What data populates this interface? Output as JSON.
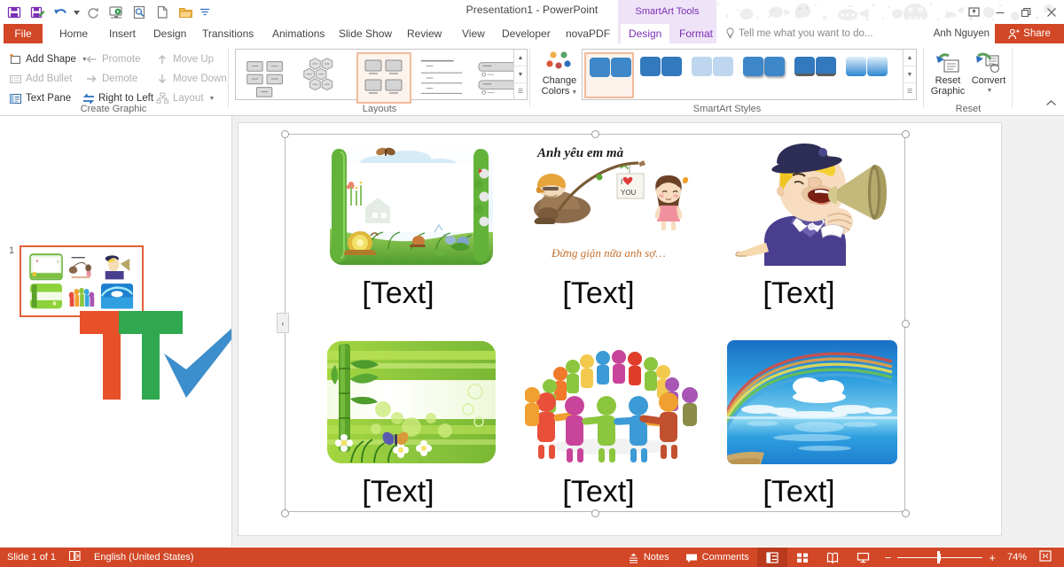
{
  "window": {
    "title": "Presentation1 - PowerPoint",
    "context_tools_label": "SmartArt Tools",
    "buttons": {
      "ribbon_display": "ribbon-display-options-icon",
      "minimize": "–",
      "restore": "❐",
      "close": "✕"
    }
  },
  "quick_access": [
    {
      "name": "save-icon",
      "label": "Save"
    },
    {
      "name": "save-as-icon",
      "label": "Save As"
    },
    {
      "name": "undo-icon",
      "label": "Undo"
    },
    {
      "name": "redo-icon",
      "label": "Redo"
    },
    {
      "name": "start-from-beginning-icon",
      "label": "Start From Beginning"
    },
    {
      "name": "print-preview-icon",
      "label": "Print Preview and Print"
    },
    {
      "name": "new-icon",
      "label": "New"
    },
    {
      "name": "open-icon",
      "label": "Open"
    },
    {
      "name": "customize-qat-icon",
      "label": "Customize Quick Access Toolbar"
    }
  ],
  "tabs": {
    "file": "File",
    "items": [
      "Home",
      "Insert",
      "Design",
      "Transitions",
      "Animations",
      "Slide Show",
      "Review",
      "View",
      "Developer",
      "novaPDF"
    ],
    "contextual": [
      "Design",
      "Format"
    ],
    "active_contextual": "Design"
  },
  "tellme": {
    "placeholder": "Tell me what you want to do...",
    "icon": "lightbulb-icon"
  },
  "account": {
    "user": "Anh Nguyen",
    "share_label": "Share",
    "share_icon": "person-share-icon"
  },
  "ribbon": {
    "collapse_icon": "chevron-up-icon",
    "groups": [
      {
        "name": "create-graphic",
        "label": "Create Graphic",
        "commands": [
          {
            "label": "Add Shape",
            "icon": "add-shape-icon",
            "enabled": true,
            "dropdown": true
          },
          {
            "label": "Add Bullet",
            "icon": "add-bullet-icon",
            "enabled": false,
            "dropdown": false
          },
          {
            "label": "Text Pane",
            "icon": "text-pane-icon",
            "enabled": true,
            "dropdown": false
          },
          {
            "label": "Promote",
            "icon": "promote-arrow-icon",
            "enabled": false,
            "dropdown": false
          },
          {
            "label": "Demote",
            "icon": "demote-arrow-icon",
            "enabled": false,
            "dropdown": false
          },
          {
            "label": "Right to Left",
            "icon": "right-to-left-icon",
            "enabled": true,
            "dropdown": false
          },
          {
            "label": "Move Up",
            "icon": "move-up-arrow-icon",
            "enabled": false,
            "dropdown": false
          },
          {
            "label": "Move Down",
            "icon": "move-down-arrow-icon",
            "enabled": false,
            "dropdown": false
          },
          {
            "label": "Layout",
            "icon": "layout-icon",
            "enabled": false,
            "dropdown": true
          }
        ]
      },
      {
        "name": "layouts",
        "label": "Layouts",
        "selected_index": 2,
        "items": [
          "layout-hierarchy",
          "layout-hexagon-cluster",
          "layout-picture-grid",
          "layout-lined-list",
          "layout-bar-list"
        ],
        "scroll": {
          "up": "▲",
          "down": "▼",
          "more": "☰"
        }
      },
      {
        "name": "smartart-styles",
        "label": "SmartArt Styles",
        "change_colors_label": "Change\nColors",
        "change_colors_line1": "Change",
        "change_colors_line2": "Colors",
        "change_colors_icon": "color-dots-icon",
        "selected_index": 0,
        "style_count": 6,
        "scroll": {
          "up": "▲",
          "down": "▼",
          "more": "☰"
        }
      },
      {
        "name": "reset",
        "label": "Reset",
        "commands": [
          {
            "label_line1": "Reset",
            "label_line2": "Graphic",
            "icon": "reset-graphic-icon",
            "dropdown": false
          },
          {
            "label_line1": "Convert",
            "label_line2": "",
            "icon": "convert-icon",
            "dropdown": true
          }
        ]
      }
    ]
  },
  "thumbnails": {
    "panel_name": "slide-thumbnail-panel",
    "slides": [
      {
        "number": "1",
        "selected": true
      }
    ],
    "watermark": "ttv-logo"
  },
  "slide": {
    "collapse_arrow": "‹",
    "smartart": {
      "name": "smartart-picture-grid",
      "cells": [
        {
          "caption": "[Text]",
          "picture": "snail-garden-frame-picture"
        },
        {
          "caption": "[Text]",
          "picture": "cartoon-couple-fishing-picture",
          "overlay_top": "Anh yêu em mà",
          "overlay_bottom": "Đừng giận nữa anh sợ…"
        },
        {
          "caption": "[Text]",
          "picture": "town-crier-megaphone-picture"
        },
        {
          "caption": "[Text]",
          "picture": "bamboo-green-banner-picture"
        },
        {
          "caption": "[Text]",
          "picture": "colorful-people-circle-picture"
        },
        {
          "caption": "[Text]",
          "picture": "rainbow-over-sea-picture"
        }
      ]
    }
  },
  "status_bar": {
    "slide_counter": "Slide 1 of 1",
    "accessibility_icon": "language-proofing-icon",
    "language": "English (United States)",
    "notes_label": "Notes",
    "notes_icon": "notes-icon",
    "comments_label": "Comments",
    "comments_icon": "comments-icon",
    "views": [
      {
        "name": "normal-view-button",
        "icon": "normal-view-icon",
        "active": true
      },
      {
        "name": "slide-sorter-view-button",
        "icon": "slide-sorter-icon",
        "active": false
      },
      {
        "name": "reading-view-button",
        "icon": "reading-view-icon",
        "active": false
      },
      {
        "name": "slide-show-button",
        "icon": "slide-show-icon",
        "active": false
      }
    ],
    "zoom_out": "−",
    "zoom_in": "+",
    "zoom_level": "74%",
    "fit_icon": "fit-to-window-icon"
  },
  "colors": {
    "accent_orange": "#d24726",
    "context_purple": "#7b2fb5",
    "context_band": "#efe3f7",
    "selection_peach": "#f2bb99"
  }
}
